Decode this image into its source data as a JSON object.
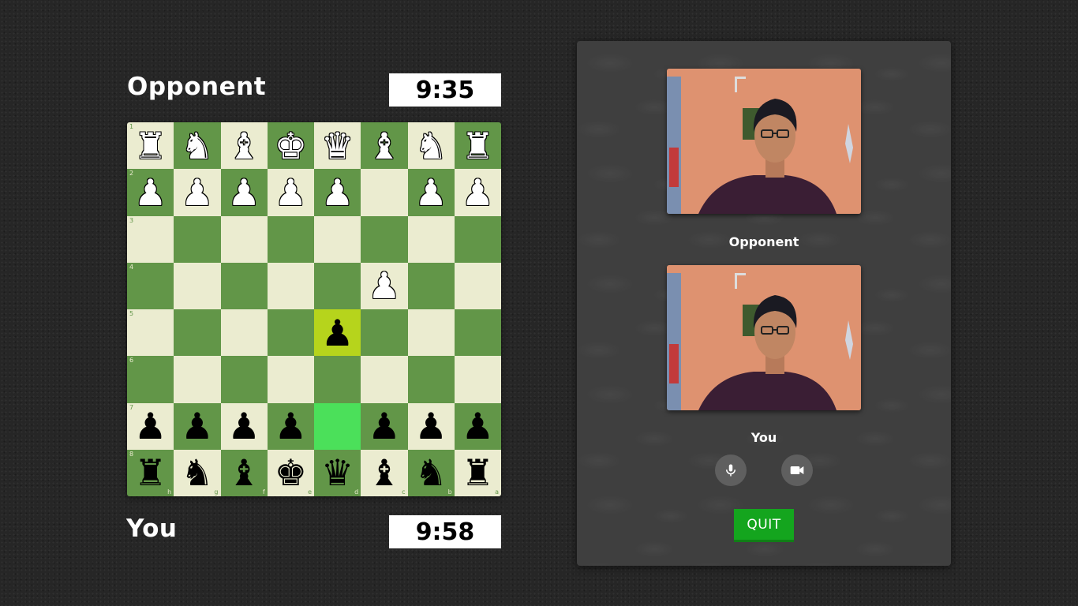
{
  "opponent": {
    "name": "Opponent",
    "clock": "9:35"
  },
  "you": {
    "name": "You",
    "clock": "9:58"
  },
  "board": {
    "orientation": "black-at-bottom",
    "rank_labels": [
      "1",
      "2",
      "3",
      "4",
      "5",
      "6",
      "7",
      "8"
    ],
    "file_labels": [
      "h",
      "g",
      "f",
      "e",
      "d",
      "c",
      "b",
      "a"
    ],
    "last_move": {
      "from": "d7",
      "to": "d5"
    },
    "colors": {
      "light": "#ebecd0",
      "dark": "#629648",
      "highlight_from": "#4be05a",
      "highlight_to": "#b6d41c"
    },
    "rows": [
      [
        "wR",
        "wN",
        "wB",
        "wK",
        "wQ",
        "wB",
        "wN",
        "wR"
      ],
      [
        "wP",
        "wP",
        "wP",
        "wP",
        "wP",
        "",
        "wP",
        "wP"
      ],
      [
        "",
        "",
        "",
        "",
        "",
        "",
        "",
        ""
      ],
      [
        "",
        "",
        "",
        "",
        "",
        "wP",
        "",
        ""
      ],
      [
        "",
        "",
        "",
        "",
        "bP",
        "",
        "",
        ""
      ],
      [
        "",
        "",
        "",
        "",
        "",
        "",
        "",
        ""
      ],
      [
        "bP",
        "bP",
        "bP",
        "bP",
        "",
        "bP",
        "bP",
        "bP"
      ],
      [
        "bR",
        "bN",
        "bB",
        "bK",
        "bQ",
        "bB",
        "bN",
        "bR"
      ]
    ]
  },
  "video_panel": {
    "opponent_label": "Opponent",
    "you_label": "You",
    "mic_icon": "microphone-icon",
    "camera_icon": "video-camera-icon",
    "quit_label": "QUIT",
    "quit_color": "#14a51e"
  }
}
